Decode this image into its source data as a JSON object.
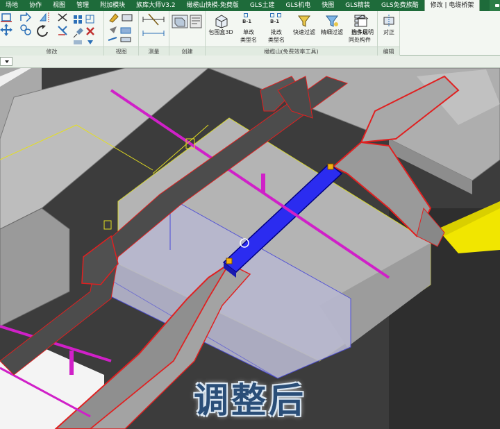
{
  "tabs": [
    {
      "label": "场地",
      "active": false
    },
    {
      "label": "协作",
      "active": false
    },
    {
      "label": "视图",
      "active": false
    },
    {
      "label": "管理",
      "active": false
    },
    {
      "label": "附加模块",
      "active": false
    },
    {
      "label": "族库大师V3.2",
      "active": false
    },
    {
      "label": "橄榄山快模-免费版",
      "active": false
    },
    {
      "label": "GLS土建",
      "active": false
    },
    {
      "label": "GLS机电",
      "active": false
    },
    {
      "label": "快图",
      "active": false
    },
    {
      "label": "GLS精装",
      "active": false
    },
    {
      "label": "GLS免费族酷",
      "active": false
    },
    {
      "label": "修改 | 电缆桥架",
      "active": true
    }
  ],
  "ribbon": {
    "panels": {
      "modify": "修改",
      "view": "视图",
      "measure": "测量",
      "create": "创建",
      "gls_tools": "橄榄山(免费效率工具)",
      "edit": "编辑"
    },
    "buttons": {
      "bbox3d": "包围盒3D",
      "single_rename_1": "单改",
      "single_rename_2": "类型名",
      "batch_rename_1": "批改",
      "batch_rename_2": "类型名",
      "quick_filter": "快速过滤",
      "fine_filter": "精细过滤",
      "multi_layer_1": "选多层",
      "multi_layer_2": "同处构件",
      "component_desc": "构件说明",
      "align": "对正"
    },
    "badges": {
      "b1": "B-1",
      "b2": "B-1"
    }
  },
  "colors": {
    "tabbar": "#1e6b3a",
    "ribbon_bg": "#f3f7f2",
    "selected_tray": "#2a3df0",
    "caption": "#2a4e78"
  },
  "caption": "调整后"
}
